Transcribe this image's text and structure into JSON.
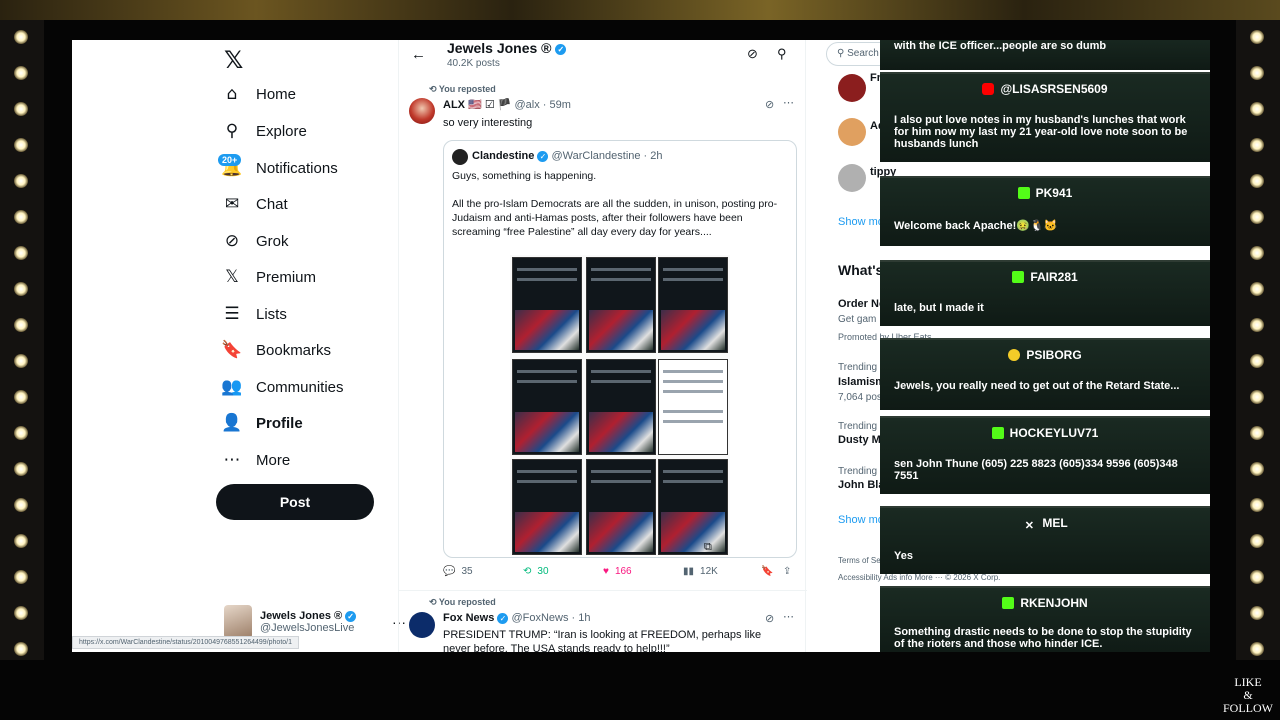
{
  "nav": {
    "logo": "𝕏",
    "items": [
      {
        "label": "Home",
        "icon": "⌂"
      },
      {
        "label": "Explore",
        "icon": "⚲"
      },
      {
        "label": "Notifications",
        "icon": "🔔"
      },
      {
        "label": "Chat",
        "icon": "✉"
      },
      {
        "label": "Grok",
        "icon": "⊘"
      },
      {
        "label": "Premium",
        "icon": "𝕏"
      },
      {
        "label": "Lists",
        "icon": "☰"
      },
      {
        "label": "Bookmarks",
        "icon": "🔖"
      },
      {
        "label": "Communities",
        "icon": "👥"
      },
      {
        "label": "Profile",
        "icon": "👤"
      },
      {
        "label": "More",
        "icon": "⋯"
      }
    ],
    "notif_badge": "20+",
    "post_label": "Post",
    "account": {
      "name": "Jewels Jones ®",
      "handle": "@JewelsJonesLive",
      "more": "···"
    },
    "status_url": "https://x.com/WarClandestine/status/2010049768551264499/photo/1"
  },
  "header": {
    "name": "Jewels Jones ®",
    "posts": "40.2K posts"
  },
  "tweet1": {
    "reposted": "You reposted",
    "author": "ALX",
    "flags": "🇺🇸 ☑ 🏴",
    "handle": "@alx · 59m",
    "text": "so very interesting",
    "quote": {
      "author": "Clandestine",
      "handle": "@WarClandestine · 2h",
      "line1": "Guys, something is happening.",
      "line2": "All the pro-Islam Democrats are all the sudden, in unison, posting pro-Judaism and anti-Hamas posts, after their followers have been screaming “free Palestine” all day every day for years...."
    },
    "actions": {
      "replies": "35",
      "reposts": "30",
      "likes": "166",
      "views": "12K"
    }
  },
  "tweet2": {
    "reposted": "You reposted",
    "author": "Fox News",
    "handle": "@FoxNews · 1h",
    "text": "PRESIDENT TRUMP: “Iran is looking at FREEDOM, perhaps like never before. The USA stands ready to help!!!”"
  },
  "right": {
    "search_placeholder": "Search",
    "who": [
      {
        "name": "Fran"
      },
      {
        "name": "Ad"
      },
      {
        "name": "tippy"
      }
    ],
    "show_more": "Show mo",
    "whats_title": "What's",
    "trend1": {
      "title": "Order No",
      "sub": "Get gam",
      "promoted": "Promoted by Uber Eats"
    },
    "trend2": {
      "label": "Trending",
      "title": "Islamism",
      "posts": "7,064 pos"
    },
    "trend3": {
      "label": "Trending in",
      "title": "Dusty Ma"
    },
    "trend4": {
      "label": "Trending in",
      "title": "John Bla"
    },
    "show_more2": "Show mo",
    "footer1": "Terms of Se",
    "footer2": "Accessibility    Ads info    More ···    © 2026 X Corp."
  },
  "chat": {
    "top_fragment": "with the ICE officer...people are so dumb",
    "messages": [
      {
        "platform": "yt",
        "user": "@LISASRSEN5609",
        "text": "I also put love notes in my husband's lunches that work for him now my last my 21 year-old love note soon to be husbands lunch"
      },
      {
        "platform": "kick",
        "user": "PK941",
        "text": "Welcome back Apache!🤢🐧🐱"
      },
      {
        "platform": "kick",
        "user": "FAIR281",
        "text": "late, but I made it"
      },
      {
        "platform": "rumble",
        "user": "PSIBORG",
        "text": "Jewels, you really need to get out of the Retard State..."
      },
      {
        "platform": "kick",
        "user": "HOCKEYLUV71",
        "text": "sen John Thune (605) 225 8823 (605)334 9596 (605)348 7551"
      },
      {
        "platform": "x",
        "user": "MEL",
        "text": "Yes"
      },
      {
        "platform": "kick",
        "user": "RKENJOHN",
        "text": "Something drastic needs to be done to stop the stupidity of the rioters and those who hinder ICE."
      }
    ]
  },
  "watermark": {
    "line1": "LIKE",
    "line2": "&",
    "line3": "FOLLOW"
  },
  "colors": {
    "x_blue": "#1d9bf0",
    "like_pink": "#f91880",
    "repost_green": "#00ba7c",
    "kick_green": "#53fc18"
  }
}
